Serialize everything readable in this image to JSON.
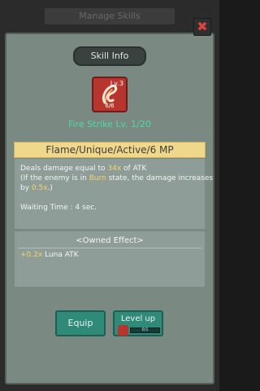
{
  "background": {
    "header_text": "Manage Skills"
  },
  "dialog": {
    "close_label": "✖",
    "title": "Skill Info"
  },
  "skill": {
    "icon_level": "Lv.3",
    "icon_count": "6/6",
    "name": "Fire Strike Lv. 1/20",
    "category": "Flame/Unique/Active/6 MP",
    "description": {
      "line1_pre": "Deals damage equal to ",
      "line1_value": "34x",
      "line1_post": " of ATK",
      "line2_pre": "(If the enemy is in ",
      "line2_value": "Burn",
      "line2_post": " state, the damage increases",
      "line3_pre": "by ",
      "line3_value": "0.5x",
      "line3_post": ".)"
    },
    "waiting_time": "Waiting Time : 4 sec."
  },
  "owned_effect": {
    "title": "<Owned Effect>",
    "value": "+0.2x",
    "text": " Luna ATK"
  },
  "buttons": {
    "equip_label": "Equip",
    "level_up_label": "Level up",
    "level_up_count": "0/1",
    "level_up_progress": 0
  },
  "colors": {
    "accent_green": "#4fd8a8",
    "highlight_yellow": "#f6d36a",
    "category_bg": "#efd88b",
    "button_teal": "#2f8a77",
    "close_red": "#e0423c"
  }
}
